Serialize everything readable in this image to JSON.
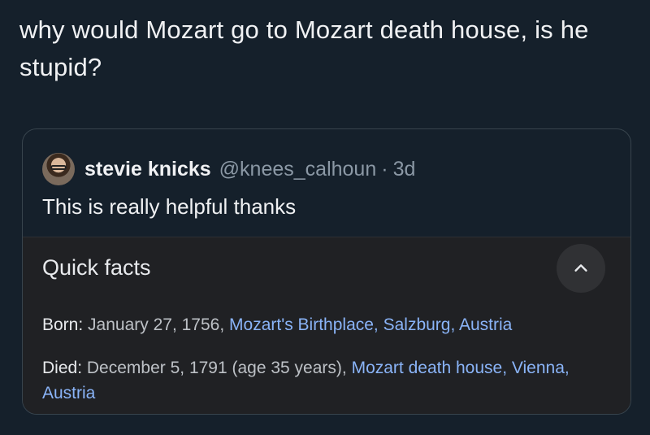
{
  "tweet": {
    "text": "why would Mozart go to Mozart death house, is he stupid?"
  },
  "quoted_tweet": {
    "display_name": "stevie knicks",
    "handle": "@knees_calhoun",
    "separator": "·",
    "age": "3d",
    "text": "This is really helpful thanks"
  },
  "quick_facts": {
    "title": "Quick facts",
    "collapse_icon": "chevron-up-icon",
    "born": {
      "label": "Born",
      "plain": "January 27, 1756,",
      "link": "Mozart's Birthplace, Salzburg, Austria"
    },
    "died": {
      "label": "Died",
      "plain": "December 5, 1791 (age 35 years),",
      "link": "Mozart death house, Vienna, Austria"
    }
  },
  "colors": {
    "background": "#15202b",
    "panel": "#202124",
    "link": "#8ab4f8",
    "muted": "#8b98a5"
  }
}
